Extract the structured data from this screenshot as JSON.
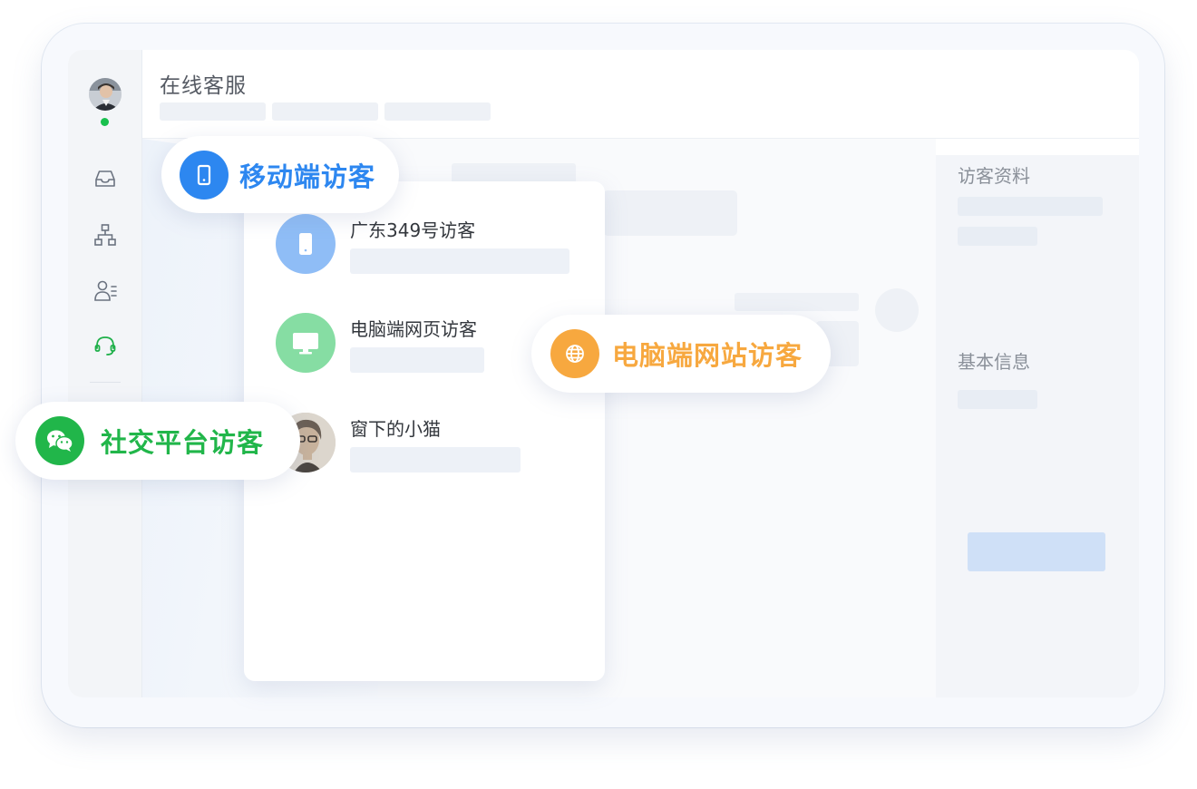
{
  "app": {
    "title": "在线客服",
    "online_status_color": "#19c04e"
  },
  "sidebar": {
    "items": [
      {
        "icon": "inbox-icon",
        "active": false
      },
      {
        "icon": "org-chart-icon",
        "active": false
      },
      {
        "icon": "contacts-list-icon",
        "active": false
      },
      {
        "icon": "headset-icon",
        "active": true
      }
    ]
  },
  "visitor_panel": {
    "profile_heading": "访客资料",
    "basic_info_heading": "基本信息"
  },
  "visitor_list": [
    {
      "name": "广东349号访客",
      "type": "mobile",
      "icon": "mobile-phone-icon",
      "color": "#8fbdf6"
    },
    {
      "name": "电脑端网页访客",
      "type": "desktop",
      "icon": "monitor-icon",
      "color": "#86dda3"
    },
    {
      "name": "窗下的小猫",
      "type": "social",
      "icon": "user-photo-avatar",
      "color": "#d7cfc4"
    }
  ],
  "badges": {
    "mobile": {
      "label": "移动端访客",
      "icon": "mobile-phone-icon",
      "color": "#2d87f0"
    },
    "website": {
      "label": "电脑端网站访客",
      "icon": "globe-icon",
      "color": "#f7a83f"
    },
    "social": {
      "label": "社交平台访客",
      "icon": "wechat-icon",
      "color": "#21b64a"
    }
  }
}
